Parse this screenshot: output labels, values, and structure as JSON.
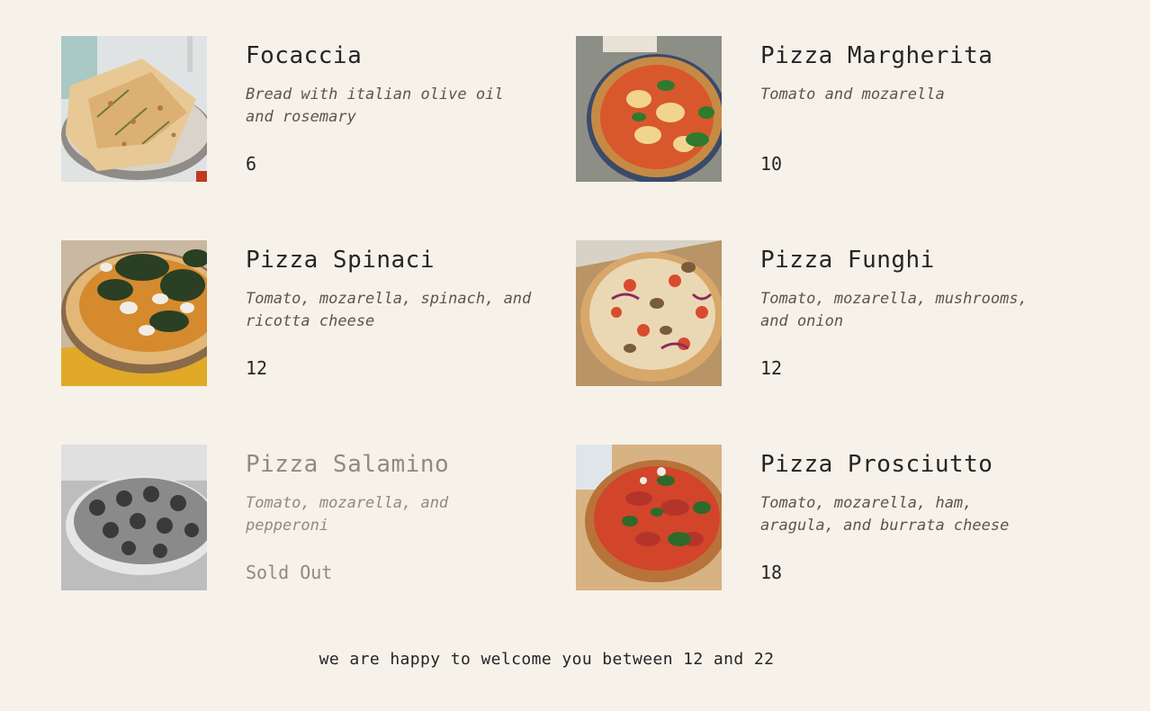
{
  "menu": {
    "items": [
      {
        "name": "Focaccia",
        "ingredients": "Bread with italian olive oil and rosemary",
        "price": "6",
        "photo_icon": "focaccia-photo",
        "sold_out": false
      },
      {
        "name": "Pizza Margherita",
        "ingredients": "Tomato and mozarella",
        "price": "10",
        "photo_icon": "pizza-margherita-photo",
        "sold_out": false
      },
      {
        "name": "Pizza Spinaci",
        "ingredients": "Tomato, mozarella, spinach, and ricotta cheese",
        "price": "12",
        "photo_icon": "pizza-spinaci-photo",
        "sold_out": false
      },
      {
        "name": "Pizza Funghi",
        "ingredients": "Tomato, mozarella, mushrooms, and onion",
        "price": "12",
        "photo_icon": "pizza-funghi-photo",
        "sold_out": false
      },
      {
        "name": "Pizza Salamino",
        "ingredients": "Tomato, mozarella, and pepperoni",
        "price": "Sold Out",
        "photo_icon": "pizza-salamino-photo",
        "sold_out": true
      },
      {
        "name": "Pizza Prosciutto",
        "ingredients": "Tomato, mozarella, ham, aragula, and burrata cheese",
        "price": "18",
        "photo_icon": "pizza-prosciutto-photo",
        "sold_out": false
      }
    ]
  },
  "footer": {
    "text": "we are happy to welcome you between 12 and 22"
  },
  "colors": {
    "background": "#f6f2ea",
    "text": "#252525",
    "muted_text": "#5a5550",
    "sold_out_text": "#8e8a84"
  }
}
